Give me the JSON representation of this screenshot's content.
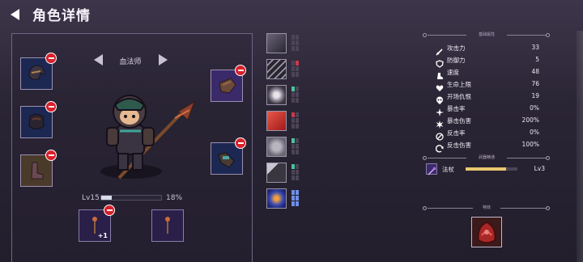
{
  "header": {
    "title": "角色详情"
  },
  "character": {
    "class_name": "血法师",
    "level_label": "Lv15",
    "level_progress": 0.18,
    "level_percent_text": "18%"
  },
  "accessories": {
    "plus_label": "+1"
  },
  "stats": {
    "section_title": "基础属性",
    "items": [
      {
        "icon": "sword-icon",
        "label": "攻击力",
        "value": "33"
      },
      {
        "icon": "shield-icon",
        "label": "防御力",
        "value": "5"
      },
      {
        "icon": "boot-icon",
        "label": "速度",
        "value": "48"
      },
      {
        "icon": "heart-icon",
        "label": "生命上限",
        "value": "76"
      },
      {
        "icon": "skull-icon",
        "label": "开场仇恨",
        "value": "19"
      },
      {
        "icon": "crit-icon",
        "label": "暴击率",
        "value": "0%"
      },
      {
        "icon": "crit-damage-icon",
        "label": "暴击伤害",
        "value": "200%"
      },
      {
        "icon": "counter-icon",
        "label": "反击率",
        "value": "0%"
      },
      {
        "icon": "counter-damage-icon",
        "label": "反击伤害",
        "value": "100%"
      }
    ]
  },
  "weapon_mastery": {
    "section_title": "武器精通",
    "weapon_name": "法杖",
    "progress": 0.78,
    "level_text": "Lv3"
  },
  "relic": {
    "section_title": "特效"
  },
  "colors": {
    "accent_red": "#d8202a",
    "pip_red": "#c83a4a",
    "pip_green": "#4cc29a",
    "pip_blue": "#6f8ee6",
    "mastery_gold": "#e9c870"
  }
}
